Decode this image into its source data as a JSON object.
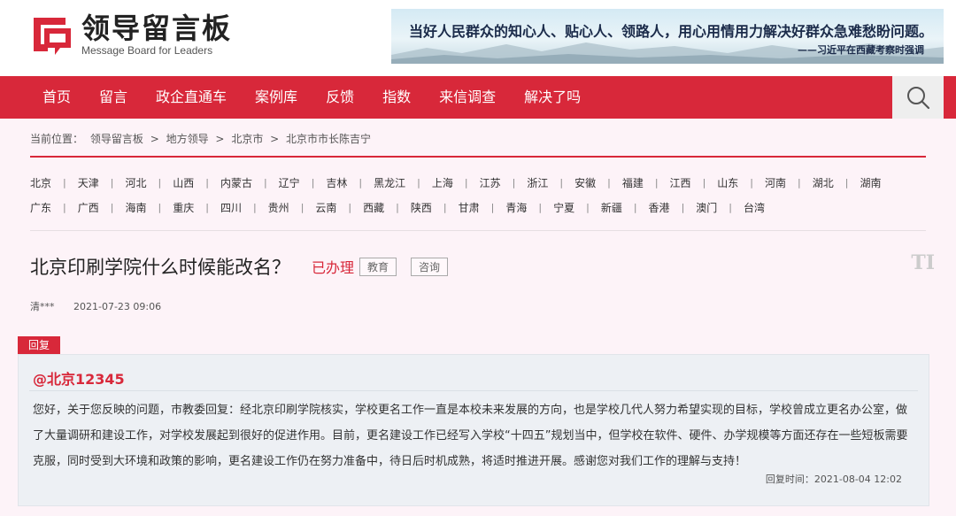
{
  "logo": {
    "cn": "领导留言板",
    "en": "Message Board for Leaders",
    "brand_color": "#d8283a"
  },
  "banner": {
    "quote": "当好人民群众的知心人、贴心人、领路人，用心用情用力解决好群众急难愁盼问题。",
    "attribution": "——习近平在西藏考察时强调"
  },
  "nav": {
    "items": [
      "首页",
      "留言",
      "政企直通车",
      "案例库",
      "反馈",
      "指数",
      "来信调查",
      "解决了吗"
    ],
    "search_icon": "search-icon"
  },
  "breadcrumb": {
    "label": "当前位置：",
    "items": [
      "领导留言板",
      "地方领导",
      "北京市",
      "北京市市长陈吉宁"
    ],
    "separator": ">"
  },
  "regions": {
    "row1": [
      "北京",
      "天津",
      "河北",
      "山西",
      "内蒙古",
      "辽宁",
      "吉林",
      "黑龙江",
      "上海",
      "江苏",
      "浙江",
      "安徽",
      "福建",
      "江西",
      "山东",
      "河南",
      "湖北",
      "湖南"
    ],
    "row2": [
      "广东",
      "广西",
      "海南",
      "重庆",
      "四川",
      "贵州",
      "云南",
      "西藏",
      "陕西",
      "甘肃",
      "青海",
      "宁夏",
      "新疆",
      "香港",
      "澳门",
      "台湾"
    ],
    "separator": "|"
  },
  "message": {
    "title": "北京印刷学院什么时候能改名？",
    "status": "已办理",
    "tags": [
      "教育",
      "咨询"
    ],
    "font_size_icon": "TI",
    "author": "清***",
    "date": "2021-07-23 09:06"
  },
  "reply": {
    "badge": "回复",
    "from": "@北京12345",
    "body": "您好，关于您反映的问题，市教委回复：经北京印刷学院核实，学校更名工作一直是本校未来发展的方向，也是学校几代人努力希望实现的目标，学校曾成立更名办公室，做了大量调研和建设工作，对学校发展起到很好的促进作用。目前，更名建设工作已经写入学校“十四五”规划当中，但学校在软件、硬件、办学规模等方面还存在一些短板需要克服，同时受到大环境和政策的影响，更名建设工作仍在努力准备中，待日后时机成熟，将适时推进开展。感谢您对我们工作的理解与支持！",
    "time_label": "回复时间：",
    "time": "2021-08-04 12:02"
  }
}
